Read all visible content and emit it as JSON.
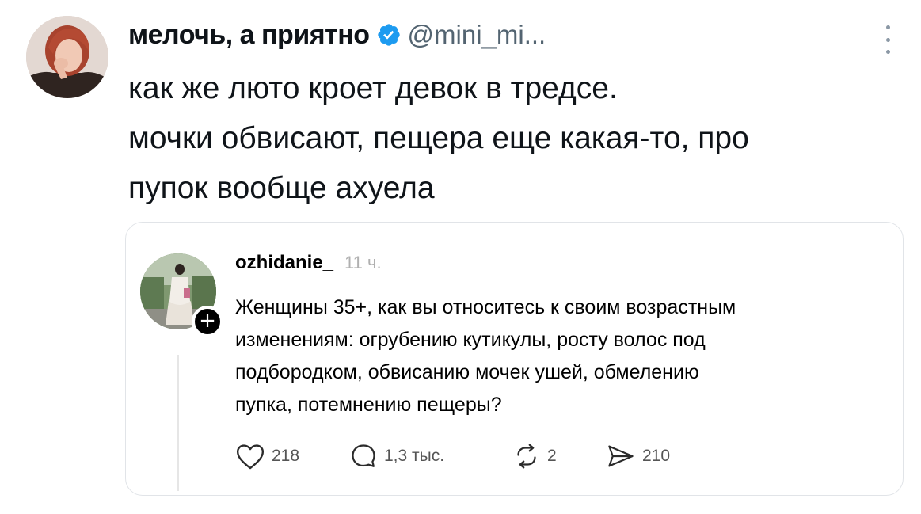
{
  "tweet": {
    "display_name": "мелочь, а приятно",
    "handle": "@mini_mi...",
    "text_lines": [
      "как же люто кроет девок в тредсе.",
      "мочки обвисают, пещера еще какая-то, про",
      "пупок вообще ахуела"
    ]
  },
  "quoted_post": {
    "username": "ozhidanie_",
    "time": "11 ч.",
    "follow_symbol": "+",
    "text_lines": [
      "Женщины 35+, как вы относитесь к своим возрастным",
      "изменениям: огрубению кутикулы, росту волос под",
      "подбородком, обвисанию мочек ушей, обмелению",
      "пупка, потемнению пещеры?"
    ],
    "actions": {
      "likes": "218",
      "replies": "1,3 тыс.",
      "reposts": "2",
      "shares": "210"
    }
  },
  "colors": {
    "verified_badge": "#1d9bf0",
    "secondary_text": "#536471",
    "card_border": "#e1e4e8"
  },
  "icons": {
    "verified": "verified-badge-icon",
    "more": "more-vertical-icon",
    "like": "heart-icon",
    "reply": "speech-bubble-icon",
    "repost": "repost-icon",
    "share": "send-icon"
  }
}
